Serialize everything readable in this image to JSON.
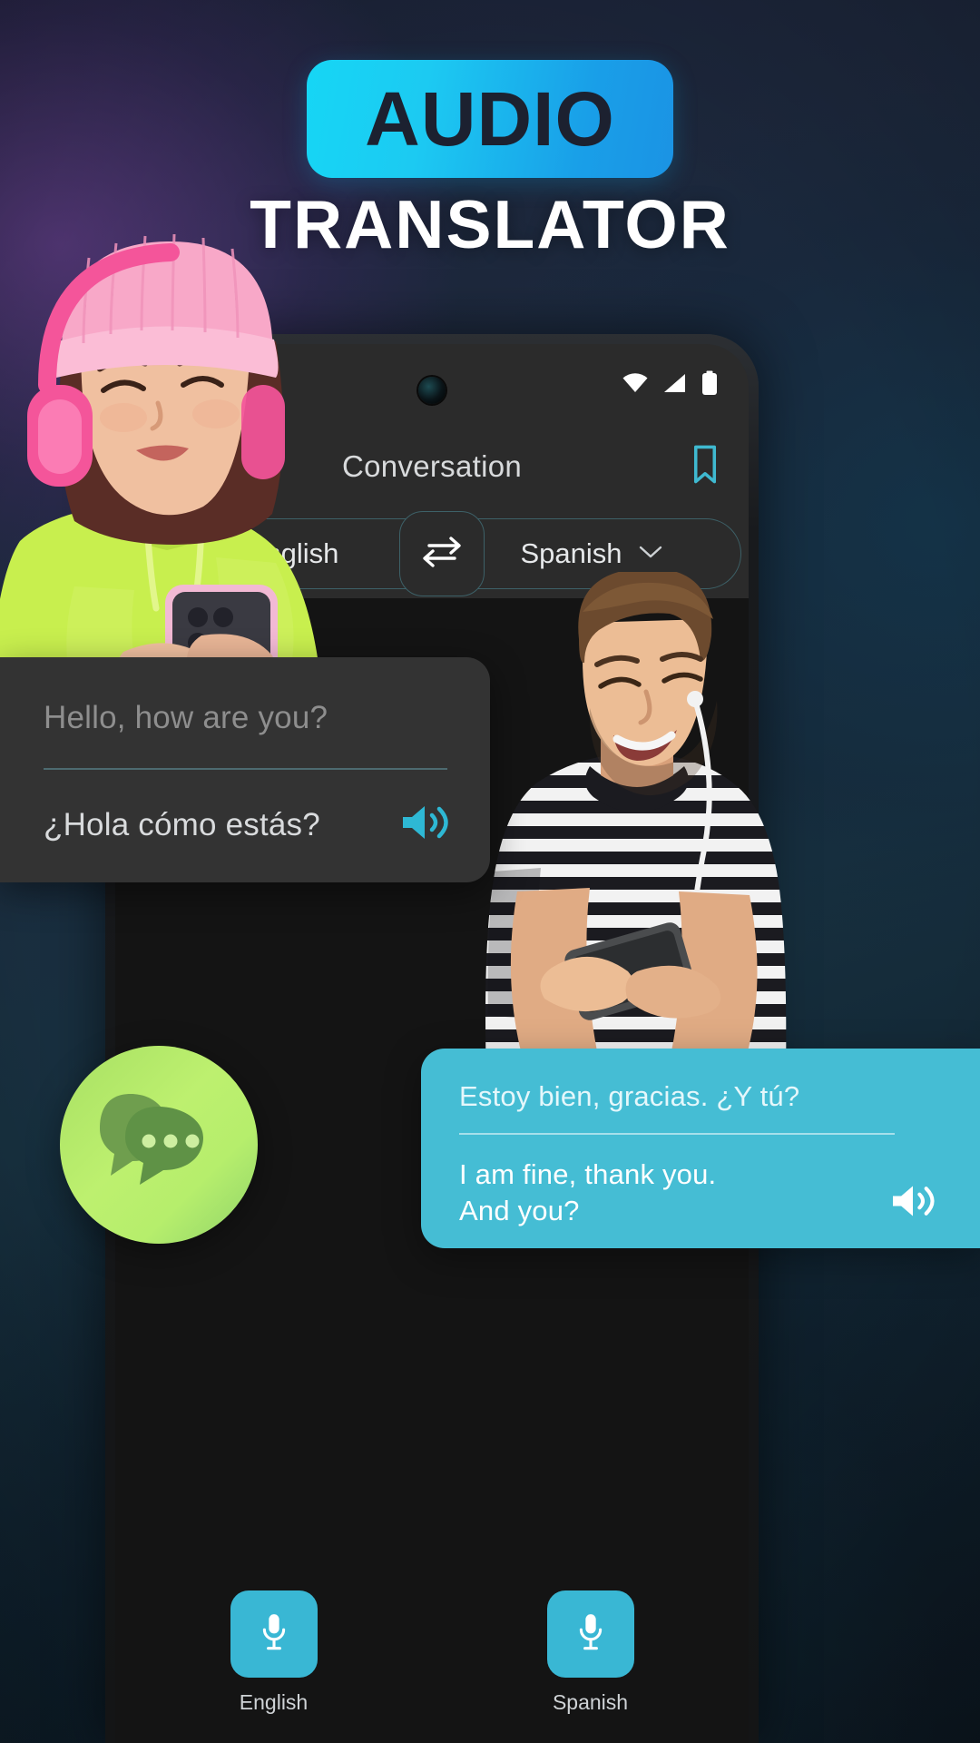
{
  "title": {
    "badge_label": "AUDIO",
    "subtitle": "TRANSLATOR"
  },
  "colors": {
    "badge_gradient_start": "#16d6f5",
    "badge_gradient_end": "#1b93e4",
    "badge_text": "#1c2130",
    "accent_cyan": "#39b7d4",
    "card_blue": "#45bdd4",
    "app_icon_green": "#b6ee6c",
    "outline_teal": "#3d6168",
    "phone_screen": "#2b2b2b"
  },
  "phone": {
    "statusbar": {
      "wifi_icon": "wifi-icon",
      "signal_icon": "signal-icon",
      "battery_icon": "battery-icon"
    },
    "header": {
      "title": "Conversation",
      "bookmark_icon": "bookmark-icon"
    },
    "language_bar": {
      "source_language": "English",
      "target_language": "Spanish",
      "swap_icon": "swap-arrows-icon",
      "chevron_icon": "chevron-down-icon"
    },
    "mic_buttons": [
      {
        "label": "English",
        "icon": "microphone-icon"
      },
      {
        "label": "Spanish",
        "icon": "microphone-icon"
      }
    ]
  },
  "cards": {
    "left": {
      "source_text": "Hello, how are you?",
      "target_text": "¿Hola cómo estás?",
      "speaker_icon": "speaker-icon"
    },
    "right": {
      "source_text": "Estoy bien, gracias. ¿Y tú?",
      "target_text": "I am fine, thank you.\nAnd you?",
      "speaker_icon": "speaker-icon"
    }
  },
  "app_icon": {
    "name": "chat-bubbles-icon"
  }
}
